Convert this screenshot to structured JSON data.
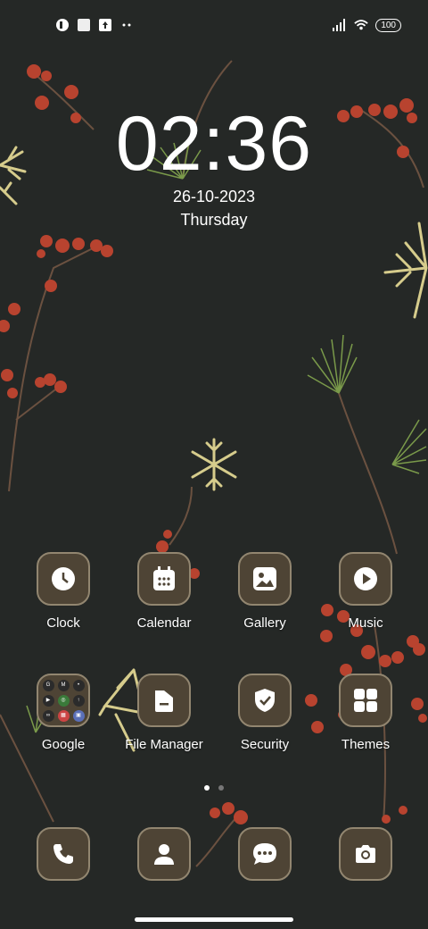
{
  "status_bar": {
    "left_icons": [
      "notification-icon",
      "square-icon",
      "upload-icon",
      "more-dots-icon"
    ],
    "right_icons": [
      "signal-icon",
      "wifi-icon"
    ],
    "battery": "100"
  },
  "lockclock": {
    "time": "02:36",
    "date": "26-10-2023",
    "day": "Thursday"
  },
  "apps_row1": [
    {
      "label": "Clock",
      "icon": "clock-icon"
    },
    {
      "label": "Calendar",
      "icon": "calendar-icon"
    },
    {
      "label": "Gallery",
      "icon": "gallery-icon"
    },
    {
      "label": "Music",
      "icon": "play-icon"
    }
  ],
  "apps_row2": [
    {
      "label": "Google",
      "icon": "folder-icon"
    },
    {
      "label": "File Manager",
      "icon": "file-icon"
    },
    {
      "label": "Security",
      "icon": "shield-icon"
    },
    {
      "label": "Themes",
      "icon": "grid-icon"
    }
  ],
  "folder_items": [
    "G",
    "M",
    "•",
    "▶",
    "◎",
    "↑",
    "∞",
    "▦",
    "▣"
  ],
  "dock": [
    "phone-icon",
    "contacts-icon",
    "messages-icon",
    "camera-icon"
  ],
  "page_indicator": {
    "pages": 2,
    "current": 1
  },
  "colors": {
    "icon_bg": "#4e4435",
    "icon_border": "#928670",
    "background": "#252826",
    "berry": "#b8432f",
    "pine": "#7a9a4a",
    "snow": "#d6cc8c"
  }
}
